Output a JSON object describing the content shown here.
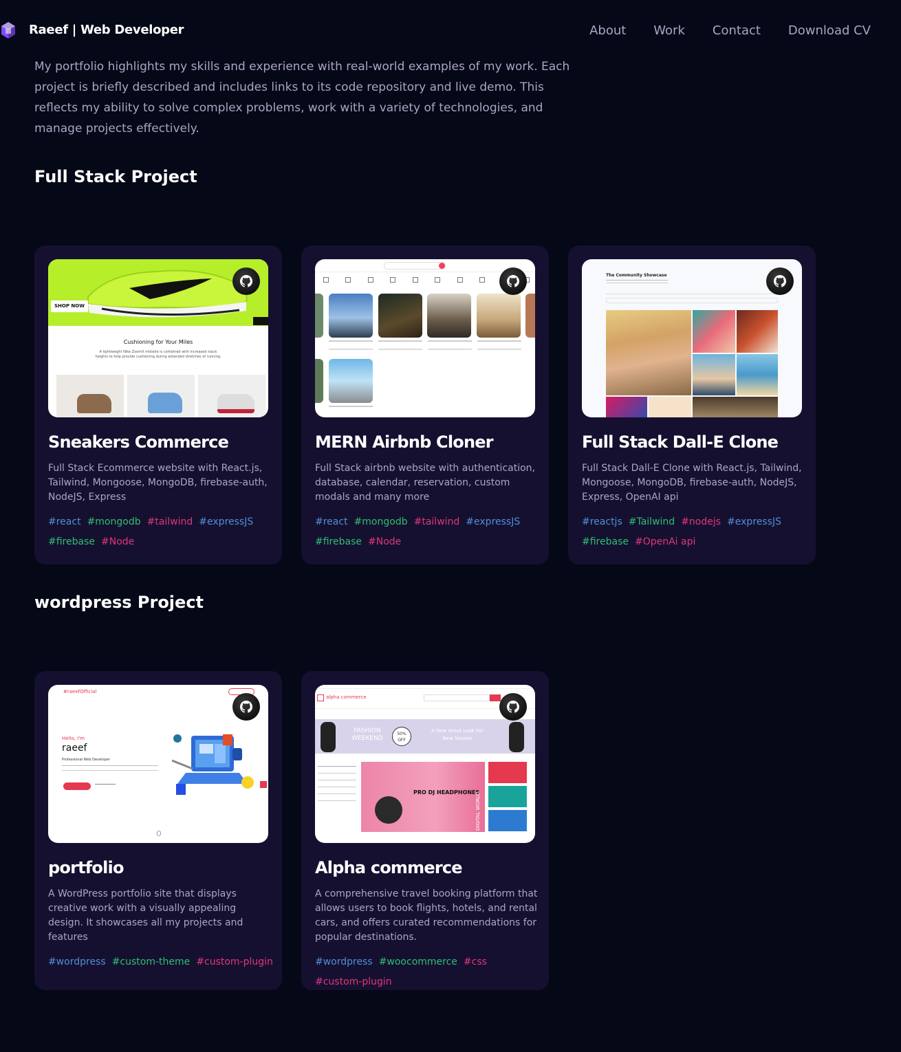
{
  "nav": {
    "brand": "Raeef | Web Developer",
    "links": [
      "About",
      "Work",
      "Contact",
      "Download CV"
    ]
  },
  "intro": "My portfolio highlights my skills and experience with real-world examples of my work. Each project is briefly described and includes links to its code repository and live demo. This reflects my ability to solve complex problems, work with a variety of technologies, and manage projects effectively.",
  "sections": [
    {
      "title": "Full Stack Project"
    },
    {
      "title": "wordpress Project"
    }
  ],
  "projects": [
    {
      "name": "Sneakers Commerce",
      "description": "Full Stack Ecommerce website with React.js, Tailwind, Mongoose, MongoDB, firebase-auth, NodeJS, Express",
      "tags": [
        {
          "text": "#react",
          "color": "blue"
        },
        {
          "text": "#mongodb",
          "color": "green"
        },
        {
          "text": "#tailwind",
          "color": "pink"
        },
        {
          "text": "#expressJS",
          "color": "blue"
        },
        {
          "text": "#firebase",
          "color": "green"
        },
        {
          "text": "#Node",
          "color": "pink"
        }
      ],
      "thumb": {
        "shop_now": "SHOP NOW",
        "heading": "Cushioning for Your Miles",
        "sub": "A lightweight Nike ZoomX midsole is combined with increased stack heights to help provide cushioning during extended stretches of running."
      }
    },
    {
      "name": "MERN Airbnb Cloner",
      "description": "Full Stack airbnb website with authentication, database, calendar, reservation, custom modals and many more",
      "tags": [
        {
          "text": "#react",
          "color": "blue"
        },
        {
          "text": "#mongodb",
          "color": "green"
        },
        {
          "text": "#tailwind",
          "color": "pink"
        },
        {
          "text": "#expressJS",
          "color": "blue"
        },
        {
          "text": "#firebase",
          "color": "green"
        },
        {
          "text": "#Node",
          "color": "pink"
        }
      ]
    },
    {
      "name": "Full Stack Dall-E Clone",
      "description": "Full Stack Dall-E Clone with React.js, Tailwind, Mongoose, MongoDB, firebase-auth, NodeJS, Express, OpenAI api",
      "tags": [
        {
          "text": "#reactjs",
          "color": "blue"
        },
        {
          "text": "#Tailwind",
          "color": "green"
        },
        {
          "text": "#nodejs",
          "color": "pink"
        },
        {
          "text": "#expressJS",
          "color": "blue"
        },
        {
          "text": "#firebase",
          "color": "green"
        },
        {
          "text": "#OpenAi api",
          "color": "pink"
        }
      ],
      "thumb": {
        "heading": "The Community Showcase"
      }
    },
    {
      "name": "portfolio",
      "description": "A WordPress portfolio site that displays creative work with a visually appealing design. It showcases all my projects and features",
      "tags": [
        {
          "text": "#wordpress",
          "color": "blue"
        },
        {
          "text": "#custom-theme",
          "color": "green"
        },
        {
          "text": "#custom-plugin",
          "color": "pink"
        }
      ],
      "thumb": {
        "logo": "#raeefOfficial",
        "hello": "Hello, I'm",
        "name": "raeef",
        "role": "Professional Web Developer"
      }
    },
    {
      "name": "Alpha commerce",
      "description": "A comprehensive travel booking platform that allows users to book flights, hotels, and rental cars, and offers curated recommendations for popular destinations.",
      "tags": [
        {
          "text": "#wordpress",
          "color": "blue"
        },
        {
          "text": "#woocommerce",
          "color": "green"
        },
        {
          "text": "#css",
          "color": "pink"
        },
        {
          "text": "#custom-plugin",
          "color": "pink"
        }
      ],
      "thumb": {
        "logo": "alpha commerce",
        "banner1": "FASHION WEEKEND",
        "banner2": "50% OFF",
        "banner3": "A New Great Look For New Season",
        "hero": "PRO DJ HEADPHONES",
        "side": "DIGITAL WORLD"
      }
    }
  ]
}
